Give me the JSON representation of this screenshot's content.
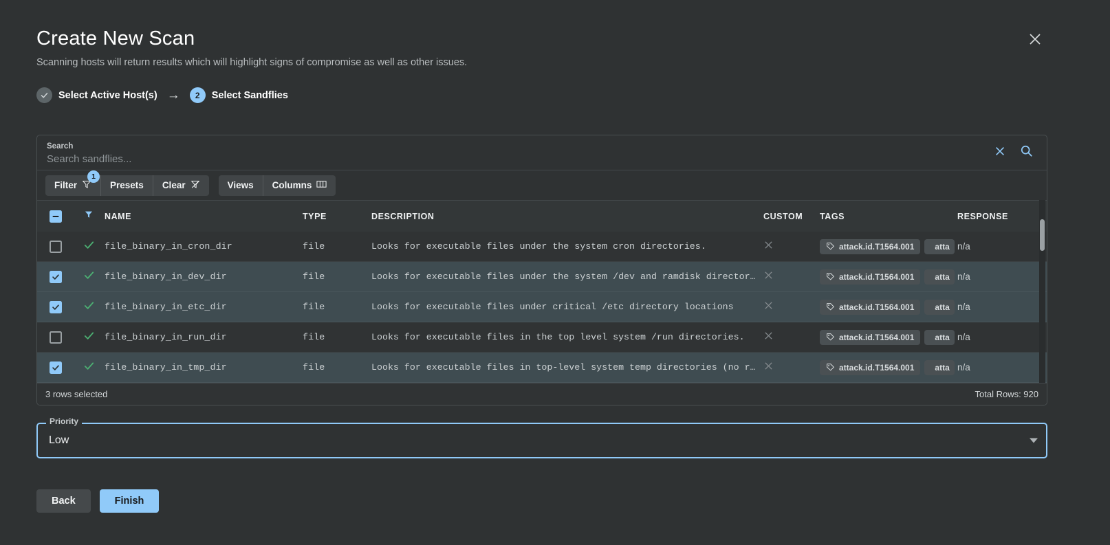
{
  "dialog": {
    "title": "Create New Scan",
    "subtitle": "Scanning hosts will return results which will highlight signs of compromise as well as other issues.",
    "close_icon": "close-icon"
  },
  "stepper": {
    "steps": [
      {
        "marker": "✓",
        "label": "Select Active Host(s)",
        "state": "done"
      },
      {
        "marker": "2",
        "label": "Select Sandflies",
        "state": "active"
      }
    ],
    "arrow": "→"
  },
  "search": {
    "label": "Search",
    "placeholder": "Search sandflies...",
    "value": "",
    "clear_icon": "close-icon",
    "search_icon": "search-icon"
  },
  "toolbar": {
    "group_one": [
      {
        "label": "Filter",
        "icon": "filter-icon",
        "badge": "1"
      },
      {
        "label": "Presets",
        "icon": "",
        "badge": ""
      },
      {
        "label": "Clear",
        "icon": "filter-off-icon",
        "badge": ""
      }
    ],
    "group_two": [
      {
        "label": "Views",
        "icon": "",
        "badge": ""
      },
      {
        "label": "Columns",
        "icon": "columns-icon",
        "badge": ""
      }
    ]
  },
  "table": {
    "columns": [
      "NAME",
      "TYPE",
      "DESCRIPTION",
      "CUSTOM",
      "TAGS",
      "RESPONSE"
    ],
    "header_select_all_state": "indeterminate",
    "header_filter_icon": "filter-icon",
    "rows": [
      {
        "selected": false,
        "enabled_icon": "check-icon",
        "name": "file_binary_in_cron_dir",
        "type": "file",
        "description": "Looks for executable files under the system cron directories.",
        "custom": "x",
        "tags": [
          "attack.id.T1564.001",
          "atta"
        ],
        "response": "n/a"
      },
      {
        "selected": true,
        "enabled_icon": "check-icon",
        "name": "file_binary_in_dev_dir",
        "type": "file",
        "description": "Looks for executable files under the system /dev and ramdisk director…",
        "custom": "x",
        "tags": [
          "attack.id.T1564.001",
          "atta"
        ],
        "response": "n/a"
      },
      {
        "selected": true,
        "enabled_icon": "check-icon",
        "name": "file_binary_in_etc_dir",
        "type": "file",
        "description": "Looks for executable files under critical /etc directory locations",
        "custom": "x",
        "tags": [
          "attack.id.T1564.001",
          "atta"
        ],
        "response": "n/a"
      },
      {
        "selected": false,
        "enabled_icon": "check-icon",
        "name": "file_binary_in_run_dir",
        "type": "file",
        "description": "Looks for executable files in the top level system /run directories.",
        "custom": "x",
        "tags": [
          "attack.id.T1564.001",
          "atta"
        ],
        "response": "n/a"
      },
      {
        "selected": true,
        "enabled_icon": "check-icon",
        "name": "file_binary_in_tmp_dir",
        "type": "file",
        "description": "Looks for executable files in top-level system temp directories (no r…",
        "custom": "x",
        "tags": [
          "attack.id.T1564.001",
          "atta"
        ],
        "response": "n/a"
      }
    ],
    "footer": {
      "selection_text": "3 rows selected",
      "total_text": "Total Rows: 920"
    }
  },
  "priority": {
    "label": "Priority",
    "value": "Low",
    "caret_icon": "chevron-down-icon"
  },
  "actions": {
    "back_label": "Back",
    "finish_label": "Finish"
  },
  "colors": {
    "accent": "#90caf9",
    "background": "#2f3233",
    "row_selected": "#3f4c51",
    "success": "#4caf72"
  }
}
